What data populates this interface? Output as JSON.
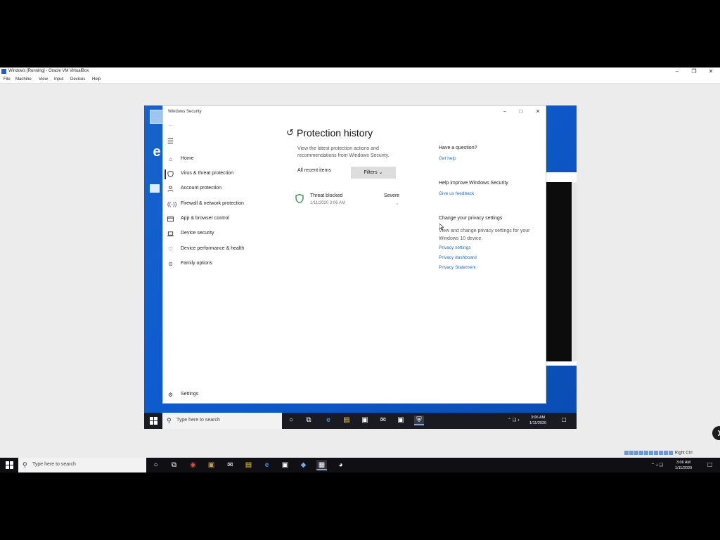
{
  "host_window": {
    "title": "Windows [Running] - Oracle VM VirtualBox",
    "menu": [
      "File",
      "Machine",
      "View",
      "Input",
      "Devices",
      "Help"
    ],
    "status_text": "Right Ctrl"
  },
  "security_window": {
    "title": "Windows Security",
    "nav": {
      "items": [
        {
          "label": "Home",
          "icon": "home-icon"
        },
        {
          "label": "Virus & threat protection",
          "icon": "shield-icon"
        },
        {
          "label": "Account protection",
          "icon": "person-icon"
        },
        {
          "label": "Firewall & network protection",
          "icon": "wifi-icon"
        },
        {
          "label": "App & browser control",
          "icon": "app-window-icon"
        },
        {
          "label": "Device security",
          "icon": "laptop-icon"
        },
        {
          "label": "Device performance & health",
          "icon": "heart-icon"
        },
        {
          "label": "Family options",
          "icon": "family-icon"
        }
      ],
      "settings_label": "Settings"
    },
    "main": {
      "heading": "Protection history",
      "description": "View the latest protection actions and recommendations from Windows Security.",
      "filter_label": "All recent items",
      "filters_button": "Filters",
      "threat": {
        "title": "Threat blocked",
        "date": "1/11/2020 3:06 AM",
        "severity": "Severe"
      }
    },
    "side": {
      "question_heading": "Have a question?",
      "get_help": "Get help",
      "improve_heading": "Help improve Windows Security",
      "feedback": "Give us feedback",
      "privacy_heading": "Change your privacy settings",
      "privacy_text": "View and change privacy settings for your Windows 10 device.",
      "privacy_settings": "Privacy settings",
      "privacy_dashboard": "Privacy dashboard",
      "privacy_statement": "Privacy Statement"
    }
  },
  "guest_taskbar": {
    "search_placeholder": "Type here to search",
    "time": "3:06 AM",
    "date": "1/11/2020"
  },
  "host_taskbar": {
    "search_placeholder": "Type here to search",
    "time": "3:06 AM",
    "date": "1/11/2020"
  },
  "colors": {
    "link": "#1f6fc0",
    "desktop_blue": "#0e5bd0",
    "shield_green": "#3a8f4b"
  }
}
